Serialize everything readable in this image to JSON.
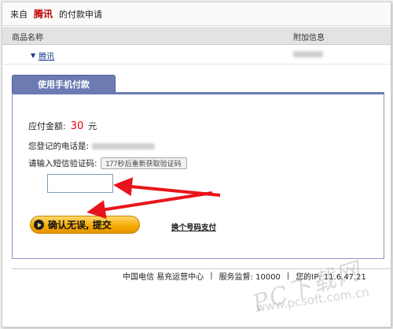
{
  "header": {
    "prefix": "来自",
    "merchant": "腾讯",
    "suffix": "的付款申请"
  },
  "table": {
    "col_product": "商品名称",
    "col_extra": "附加信息",
    "row": {
      "product": "腾讯"
    }
  },
  "tab": {
    "label": "使用手机付款"
  },
  "payment": {
    "amount_label": "应付金额:",
    "amount_value": "30",
    "amount_unit": "元",
    "phone_label": "您登记的电话是:",
    "code_label": "请输入短信验证码:",
    "resend_label": "177秒后重新获取验证码",
    "submit_label": "确认无误, 提交",
    "switch_label": "换个号码支付"
  },
  "footer": {
    "org": "中国电信 易充运营中心",
    "separator": "|",
    "hotline": "服务监督: 10000",
    "extra": "您的IP: 11.6.47.21"
  },
  "watermark": {
    "brand": "PC下载网",
    "url": "www.pcsoft.com.cn"
  },
  "colors": {
    "merchant": "#c00000",
    "amount": "#e60012",
    "tab_bg": "#6c7bb2",
    "link": "#1a3a8c",
    "button": "#f5a800",
    "arrow": "#e8141b"
  }
}
